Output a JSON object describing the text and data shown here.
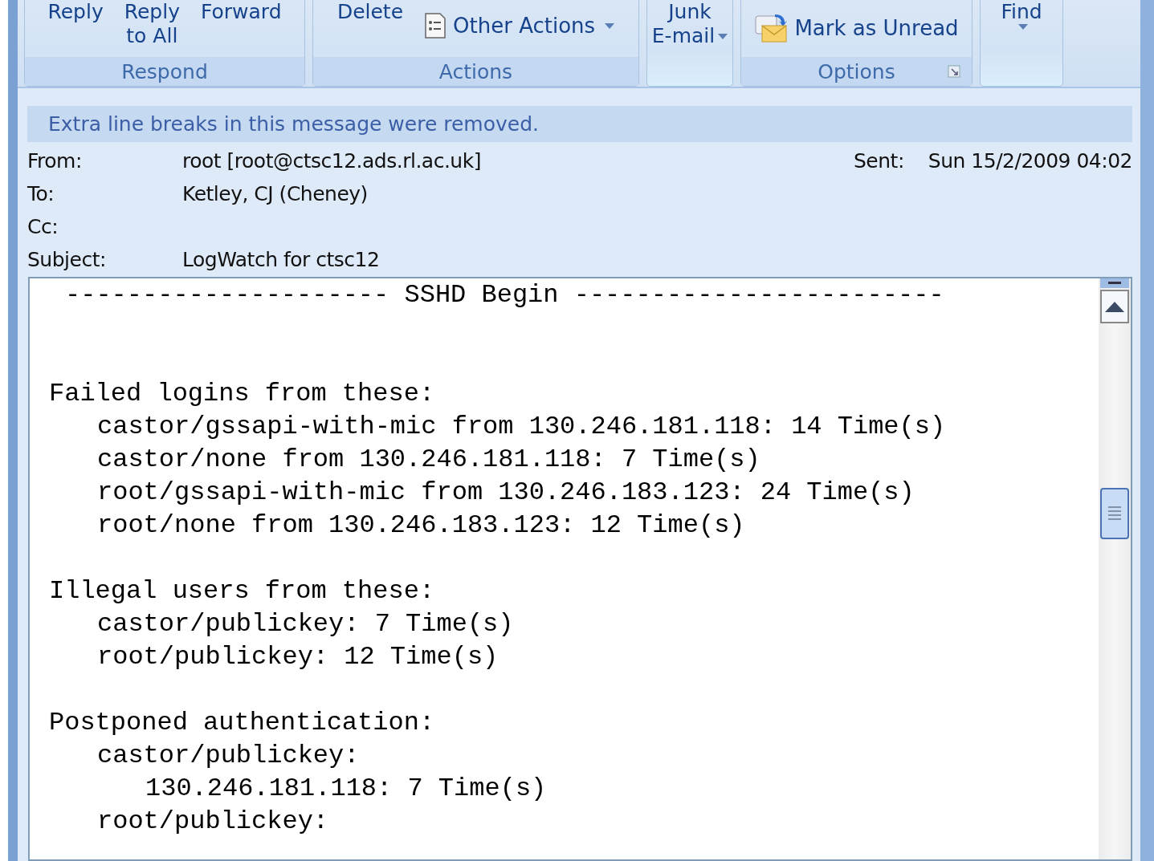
{
  "ribbon": {
    "groups": [
      {
        "label": "Respond",
        "buttons": [
          {
            "kind": "large",
            "lines": [
              "Reply"
            ]
          },
          {
            "kind": "large",
            "lines": [
              "Reply",
              "to All"
            ]
          },
          {
            "kind": "large",
            "lines": [
              "Forward"
            ]
          }
        ]
      },
      {
        "label": "Actions",
        "buttons": [
          {
            "kind": "large",
            "lines": [
              "Delete"
            ]
          },
          {
            "kind": "small",
            "label": "Other Actions",
            "caret": true
          }
        ]
      },
      {
        "buttons": [
          {
            "kind": "large",
            "lines": [
              "Junk",
              "E-mail"
            ],
            "caret": true
          }
        ]
      },
      {
        "label": "Options",
        "launcher": true,
        "buttons": [
          {
            "kind": "small",
            "label": "Mark as Unread"
          }
        ]
      },
      {
        "buttons": [
          {
            "kind": "large",
            "lines": [
              "Find"
            ],
            "caret": true
          }
        ]
      }
    ]
  },
  "info_bar": "Extra line breaks in this message were removed.",
  "header": {
    "fields": [
      {
        "label": "From:",
        "value": "root [root@ctsc12.ads.rl.ac.uk]"
      },
      {
        "label": "To:",
        "value": "Ketley, CJ (Cheney)"
      },
      {
        "label": "Cc:"
      },
      {
        "label": "Subject:",
        "value": "LogWatch for ctsc12"
      }
    ],
    "sent": {
      "label": "Sent:",
      "value": "Sun 15/2/2009 04:02"
    }
  },
  "body": {
    "banner": "--------------------- SSHD Begin ------------------------",
    "sections": [
      {
        "title": "Failed logins from these:",
        "items": [
          {
            "text": "castor/gssapi-with-mic from 130.246.181.118: 14 Time(s)"
          },
          {
            "text": "castor/none from 130.246.181.118: 7 Time(s)"
          },
          {
            "text": "root/gssapi-with-mic from 130.246.183.123: 24 Time(s)"
          },
          {
            "text": "root/none from 130.246.183.123: 12 Time(s)"
          }
        ]
      },
      {
        "title": "Illegal users from these:",
        "items": [
          {
            "text": "castor/publickey: 7 Time(s)"
          },
          {
            "text": "root/publickey: 12 Time(s)"
          }
        ]
      },
      {
        "title": "Postponed authentication:",
        "items": [
          {
            "text": "castor/publickey:",
            "children": [
              {
                "text": "130.246.181.118: 7 Time(s)"
              }
            ]
          },
          {
            "text": "root/publickey:"
          }
        ]
      }
    ]
  }
}
